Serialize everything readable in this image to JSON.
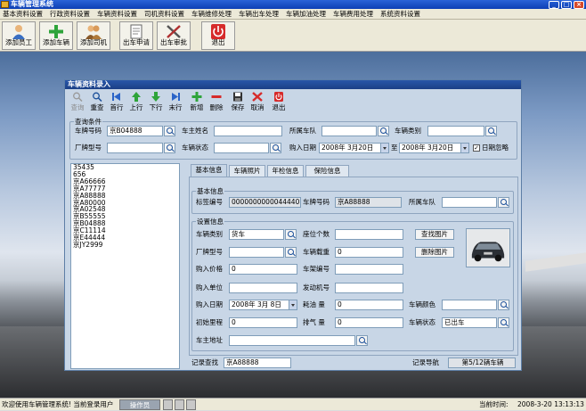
{
  "app": {
    "title": "车辆管理系统"
  },
  "menu": [
    "基本资料设置",
    "行政资料设置",
    "车辆资料设置",
    "司机资料设置",
    "车辆维修处理",
    "车辆出车处理",
    "车辆加油处理",
    "车辆费用处理",
    "系统资料设置"
  ],
  "toolbar": [
    {
      "label": "添加员工",
      "icon": "add-employee-icon"
    },
    {
      "label": "添加车辆",
      "icon": "add-vehicle-icon"
    },
    {
      "label": "添加司机",
      "icon": "add-driver-icon"
    },
    {
      "label": "出车申请",
      "icon": "dispatch-request-icon"
    },
    {
      "label": "出车审批",
      "icon": "dispatch-approve-icon"
    },
    {
      "label": "退出",
      "icon": "exit-icon"
    }
  ],
  "dialog": {
    "title": "车辆资料录入",
    "buttons": [
      {
        "label": "查询",
        "icon": "query-icon",
        "disabled": true
      },
      {
        "label": "重查",
        "icon": "requery-icon"
      },
      {
        "label": "首行",
        "icon": "first-row-icon"
      },
      {
        "label": "上行",
        "icon": "previous-row-icon"
      },
      {
        "label": "下行",
        "icon": "next-row-icon"
      },
      {
        "label": "末行",
        "icon": "last-row-icon"
      },
      {
        "label": "新增",
        "icon": "add-icon"
      },
      {
        "label": "删除",
        "icon": "delete-icon"
      },
      {
        "label": "保存",
        "icon": "save-icon"
      },
      {
        "label": "取消",
        "icon": "cancel-icon"
      },
      {
        "label": "退出",
        "icon": "exit-icon"
      }
    ],
    "query": {
      "legend": "查询条件",
      "plate_label": "车牌号码",
      "plate_value": "京B04888",
      "owner_label": "车主姓名",
      "owner_value": "",
      "team_label": "所属车队",
      "team_value": "",
      "type_label": "车辆类别",
      "type_value": "",
      "model_label": "厂牌型号",
      "model_value": "",
      "status_label": "车辆状态",
      "status_value": "",
      "date_label": "购入日期",
      "date_from": "2008年 3月20日",
      "to_label": "至",
      "date_to": "2008年 3月20日",
      "date_ignore_label": "日期忽略",
      "date_ignore_checked": true
    },
    "plates": [
      "35435",
      "656",
      "京A66666",
      "京A77777",
      "京A88888",
      "京A80000",
      "京A02548",
      "京B55555",
      "京B04888",
      "京C11114",
      "京E44444",
      "京JY2999"
    ],
    "tabs": [
      "基本信息",
      "车辆照片",
      "年检信息",
      "保险信息"
    ],
    "basic": {
      "legend": "基本信息",
      "label_no_label": "标签编号",
      "label_no_value": "00000000000444407",
      "plate_label": "车牌号码",
      "plate_value": "京A88888",
      "team_label": "所属车队",
      "team_value": ""
    },
    "setup": {
      "legend": "设置信息",
      "type_label": "车辆类别",
      "type_value": "货车",
      "seats_label": "座位个数",
      "seats_value": "",
      "model_label": "厂牌型号",
      "model_value": "",
      "load_label": "车辆载重",
      "load_value": "0",
      "price_label": "购入价格",
      "price_value": "0",
      "frame_label": "车架编号",
      "frame_value": "",
      "unit_label": "购入单位",
      "unit_value": "",
      "engine_label": "发动机号",
      "engine_value": "",
      "buy_date_label": "购入日期",
      "buy_date_value": "2008年 3月 8日",
      "fuel_label": "耗油 量",
      "fuel_value": "0",
      "color_label": "车辆颜色",
      "color_value": "",
      "mileage_label": "初始里程",
      "mileage_value": "0",
      "displacement_label": "排气 量",
      "displacement_value": "0",
      "status_label": "车辆状态",
      "status_value": "已出车",
      "address_label": "车主地址",
      "address_value": "",
      "find_photo": "查找图片",
      "remove_photo": "删除图片"
    },
    "record_search_label": "记录查找",
    "record_search_value": "京A88888",
    "record_nav_label": "记录导航",
    "record_nav_value": "第5/12辆车辆"
  },
  "status": {
    "welcome": "欢迎使用车辆管理系统! 当前登录用户",
    "user": "操作员",
    "time_label": "当前时间:",
    "time_value": "2008-3-20 13:13:13"
  },
  "colors": {
    "title_blue": "#1b3f86",
    "dialog_bg": "#c8d6e6",
    "accent_green": "#2ea43a",
    "accent_red": "#d62a2a"
  }
}
